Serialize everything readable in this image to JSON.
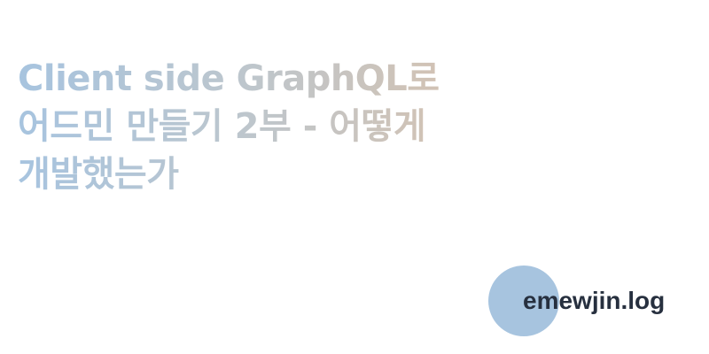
{
  "post": {
    "title_lines": [
      "Client side GraphQL로",
      "어드민 만들기 2부 - 어떻게",
      "개발했는가"
    ]
  },
  "brand": {
    "name": "emewjin.log"
  },
  "colors": {
    "title_gradient": [
      "#a7c4df",
      "#bdc6cd",
      "#d9c1ab"
    ],
    "brand_circle": "#a7c4df",
    "brand_text": "#27303f",
    "background": "#ffffff"
  }
}
